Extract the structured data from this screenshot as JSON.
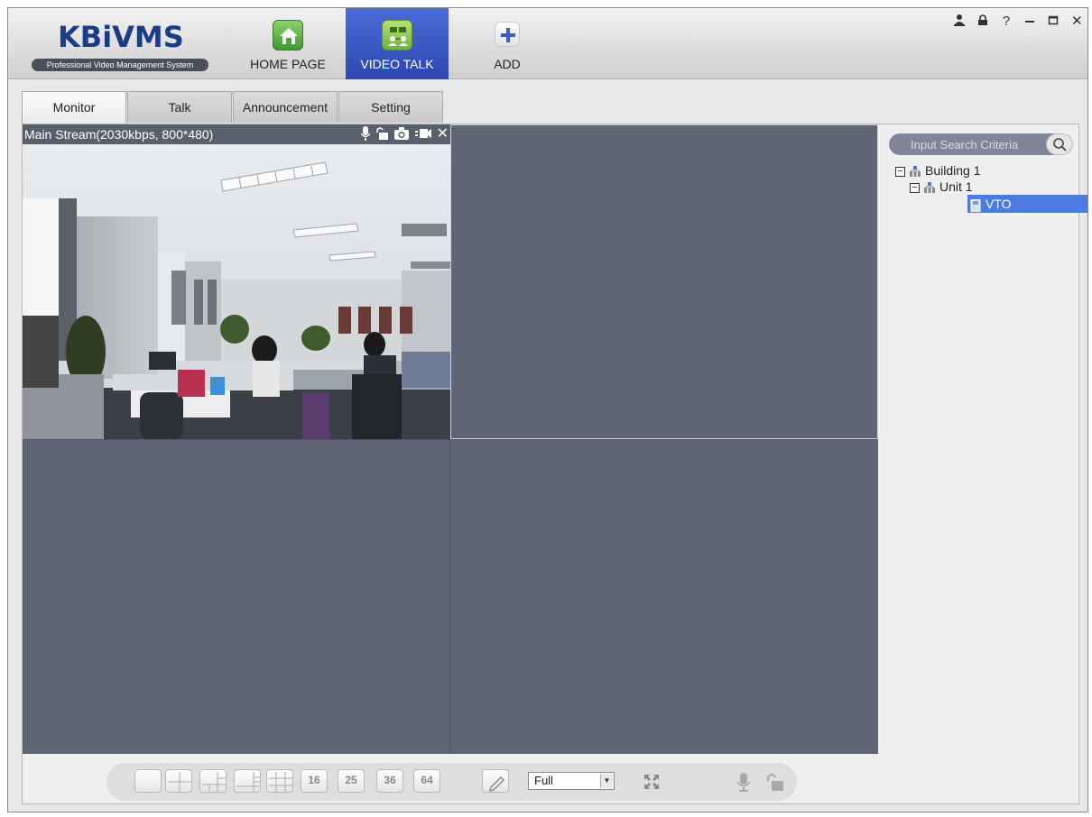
{
  "app": {
    "logo_main": "KBiVMS",
    "logo_sub": "Professional Video Management System"
  },
  "nav": {
    "home_label": "HOME PAGE",
    "video_talk_label": "VIDEO TALK",
    "add_label": "ADD"
  },
  "window_controls": [
    "user-icon",
    "lock-icon",
    "help-icon",
    "minimize-icon",
    "maximize-icon",
    "close-icon"
  ],
  "tabs": [
    {
      "label": "Monitor",
      "active": true
    },
    {
      "label": "Talk",
      "active": false
    },
    {
      "label": "Announcement",
      "active": false
    },
    {
      "label": "Setting",
      "active": false
    }
  ],
  "video": {
    "header": "Main Stream(2030kbps, 800*480)",
    "tool_icons": [
      "microphone-icon",
      "unlock-icon",
      "camera-snapshot-icon",
      "record-icon",
      "close-icon"
    ]
  },
  "search": {
    "placeholder": "Input Search Criteria"
  },
  "tree": {
    "building": "Building 1",
    "unit": "Unit 1",
    "device": "VTO"
  },
  "toolbar": {
    "split_labels": [
      "16",
      "25",
      "36",
      "64"
    ],
    "scale_option": "Full"
  },
  "colors": {
    "accent_blue": "#2f4bb5",
    "grid_bg": "#5f6575",
    "selection": "#4c7be0"
  }
}
